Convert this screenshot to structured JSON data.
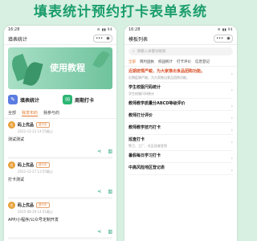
{
  "banner": {
    "title": "填表统计预约打卡表单系统"
  },
  "left": {
    "status": {
      "time": "16:28",
      "icons": "⚙ ▮▮ 94"
    },
    "nav": {
      "title": "填表统计",
      "menu": "•••",
      "close": "◉"
    },
    "hero": {
      "text": "使用教程"
    },
    "features": [
      {
        "label": "填表统计",
        "icon": "✎",
        "color": "#5b7ce0"
      },
      {
        "label": "周期打卡",
        "icon": "✉",
        "color": "#2bb673"
      }
    ],
    "tabs": [
      "全部",
      "我发布的",
      "我参与的"
    ],
    "active_tab": "我发布的",
    "cards": [
      {
        "avatar": "优",
        "name": "码上优品",
        "badge": "进行中",
        "time": "2022-12-23 14:55截止",
        "title": "测试测试"
      },
      {
        "avatar": "优",
        "name": "码上优品",
        "badge": "进行中",
        "time": "2022-12-27 13:55截止",
        "title": "打卡测试"
      },
      {
        "avatar": "优",
        "name": "码上优品",
        "badge": "进行中",
        "time": "2025-08-29 14:51截止",
        "title": "APP/小程序/公众号定制开发"
      }
    ]
  },
  "right": {
    "status": {
      "time": "16:28",
      "icons": "⚙ ▮▮ 94"
    },
    "nav": {
      "title": "模板列表",
      "menu": "•••",
      "close": "◉"
    },
    "search": {
      "icon": "⌕",
      "placeholder": "请输入关键词搜索"
    },
    "categories": [
      "全部",
      "简约固执",
      "校园统计",
      "打卡评价",
      "信息登记"
    ],
    "active_category": "全部",
    "rows": [
      {
        "title": "近期疫情严峻，为大家推出食品团购功能。",
        "sub": "近期疫情严峻，为大家推出食品团购功能。"
      },
      {
        "title": "学生校服尺码统计",
        "sub": "学生校服尺码统计"
      },
      {
        "title": "教师教学质量分ABCD等级评价",
        "sub": ""
      },
      {
        "title": "教师打分评价",
        "sub": ""
      },
      {
        "title": "教师教学技巧打卡",
        "sub": ""
      },
      {
        "title": "巡查打卡",
        "sub": "警卫、工厂、社区巡查签到"
      },
      {
        "title": "暑假每日学习打卡",
        "sub": ""
      },
      {
        "title": "中高风险地区登记表",
        "sub": ""
      }
    ]
  }
}
